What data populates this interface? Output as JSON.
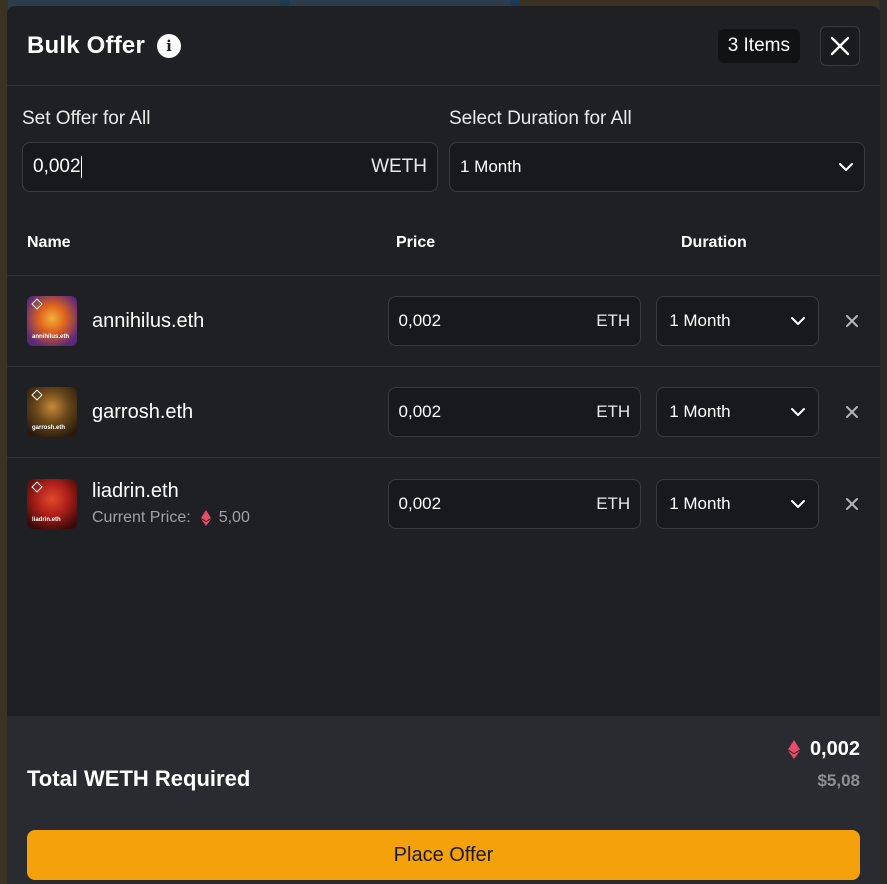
{
  "header": {
    "title": "Bulk Offer",
    "items_count": "3 Items"
  },
  "bulk": {
    "offer_label": "Set Offer for All",
    "offer_value": "0,002",
    "offer_unit": "WETH",
    "duration_label": "Select Duration for All",
    "duration_value": "1 Month"
  },
  "columns": {
    "name": "Name",
    "price": "Price",
    "duration": "Duration"
  },
  "rows": [
    {
      "name": "annihilus.eth",
      "thumb_caption": "annihilus.eth",
      "price": "0,002",
      "unit": "ETH",
      "duration": "1 Month",
      "thumb_colors": [
        "#e0641c",
        "#5a2a7a"
      ]
    },
    {
      "name": "garrosh.eth",
      "thumb_caption": "garrosh.eth",
      "price": "0,002",
      "unit": "ETH",
      "duration": "1 Month",
      "thumb_colors": [
        "#6b4a1a",
        "#2a1a0e"
      ]
    },
    {
      "name": "liadrin.eth",
      "thumb_caption": "liadrin.eth",
      "sub_label": "Current Price:",
      "sub_value": "5,00",
      "price": "0,002",
      "unit": "ETH",
      "duration": "1 Month",
      "thumb_colors": [
        "#b0201a",
        "#3a0a0a"
      ]
    }
  ],
  "footer": {
    "total_label": "Total WETH Required",
    "total_eth": "0,002",
    "total_usd": "$5,08",
    "place_label": "Place Offer"
  },
  "colors": {
    "accent": "#f4a10c",
    "eth_icon": "#e84a6a",
    "background": "#1f2023"
  },
  "icons": {
    "info": "info-icon",
    "close": "close-icon",
    "chevron": "chevron-down-icon",
    "remove": "remove-x-icon",
    "eth": "eth-diamond-icon"
  }
}
